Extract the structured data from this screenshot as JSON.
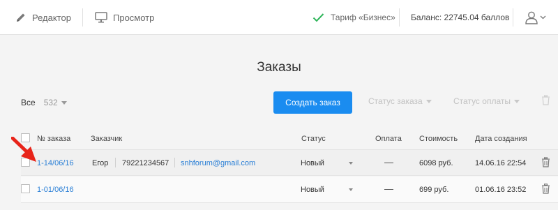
{
  "topbar": {
    "editor_label": "Редактор",
    "preview_label": "Просмотр",
    "tariff_label": "Тариф «Бизнес»",
    "balance_label": "Баланс: 22745.04 баллов",
    "icons": [
      "pencil-icon",
      "monitor-icon",
      "check-icon",
      "user-icon",
      "chevron-down-icon"
    ]
  },
  "page": {
    "title": "Заказы"
  },
  "filters": {
    "all_label": "Все",
    "all_count": "532",
    "create_button": "Создать заказ",
    "order_status_label": "Статус заказа",
    "payment_status_label": "Статус оплаты"
  },
  "table": {
    "columns": {
      "number": "№ заказа",
      "customer": "Заказчик",
      "status": "Статус",
      "payment": "Оплата",
      "price": "Стоимость",
      "created": "Дата создания"
    },
    "rows": [
      {
        "number": "1-14/06/16",
        "name": "Егор",
        "phone": "79221234567",
        "email": "snhforum@gmail.com",
        "status": "Новый",
        "payment": "—",
        "price": "6098 руб.",
        "created": "14.06.16 22:54"
      },
      {
        "number": "1-01/06/16",
        "name": "",
        "phone": "",
        "email": "",
        "status": "Новый",
        "payment": "—",
        "price": "699 руб.",
        "created": "01.06.16 23:52"
      }
    ]
  },
  "colors": {
    "accent": "#1a8cf0",
    "link": "#2a7fd6",
    "check": "#2fb55a",
    "arrow": "#e8241a"
  }
}
